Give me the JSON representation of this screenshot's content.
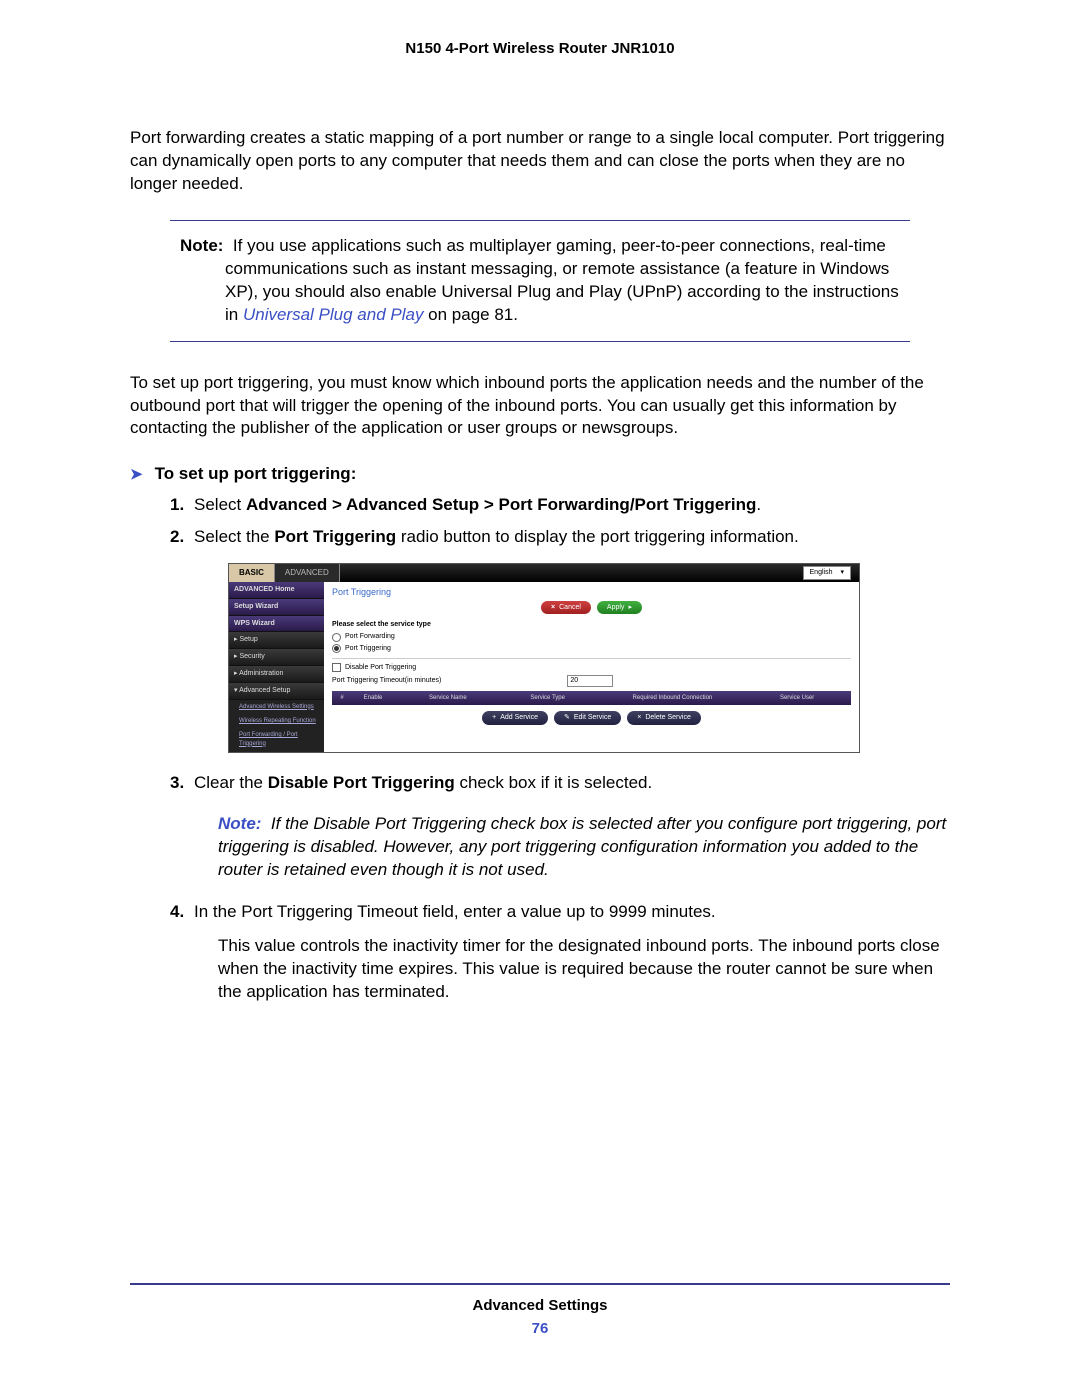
{
  "header": "N150 4-Port Wireless Router JNR1010",
  "intro": "Port forwarding creates a static mapping of a port number or range to a single local computer. Port triggering can dynamically open ports to any computer that needs them and can close the ports when they are no longer needed.",
  "note1": {
    "label": "Note:",
    "text_a": "If you use applications such as multiplayer gaming, peer-to-peer connections, real-time communications such as instant messaging, or remote assistance (a feature in Windows XP), you should also enable Universal Plug and Play (UPnP) according to the instructions in ",
    "link": "Universal Plug and Play",
    "text_b": " on page 81."
  },
  "para2": "To set up port triggering, you must know which inbound ports the application needs and the number of the outbound port that will trigger the opening of the inbound ports. You can usually get this information by contacting the publisher of the application or user groups or newsgroups.",
  "task_heading": "To set up port triggering:",
  "steps": {
    "s1_a": "Select ",
    "s1_b": "Advanced > Advanced Setup > Port Forwarding/Port Triggering",
    "s1_c": ".",
    "s2_a": "Select the ",
    "s2_b": "Port Triggering",
    "s2_c": " radio button to display the port triggering information.",
    "s3_a": "Clear the ",
    "s3_b": "Disable Port Triggering",
    "s3_c": " check box if it is selected.",
    "s4": "In the Port Triggering Timeout field, enter a value up to 9999 minutes.",
    "s4_para": "This value controls the inactivity timer for the designated inbound ports. The inbound ports close when the inactivity time expires. This value is required because the router cannot be sure when the application has terminated."
  },
  "note2": {
    "label": "Note:",
    "text": "If the Disable Port Triggering check box is selected after you configure port triggering, port triggering is disabled. However, any port triggering configuration information you added to the router is retained even though it is not used."
  },
  "screenshot": {
    "tabs": {
      "basic": "BASIC",
      "advanced": "ADVANCED"
    },
    "language": "English",
    "side": {
      "home": "ADVANCED Home",
      "setup_wizard": "Setup Wizard",
      "wps": "WPS Wizard",
      "setup": "▸ Setup",
      "security": "▸ Security",
      "admin": "▸ Administration",
      "adv_setup": "▾ Advanced Setup",
      "sub1": "Advanced Wireless Settings",
      "sub2": "Wireless Repeating Function",
      "sub3": "Port Forwarding / Port Triggering"
    },
    "main": {
      "title": "Port Triggering",
      "cancel": "Cancel",
      "apply": "Apply",
      "select_label": "Please select the service type",
      "r1": "Port Forwarding",
      "r2": "Port Triggering",
      "disable": "Disable Port Triggering",
      "timeout_label": "Port Triggering Timeout(in minutes)",
      "timeout_value": "20",
      "th_num": "#",
      "th_enable": "Enable",
      "th_name": "Service Name",
      "th_type": "Service Type",
      "th_inbound": "Required Inbound Connection",
      "th_user": "Service User",
      "add": "Add Service",
      "edit": "Edit Service",
      "del": "Delete Service"
    }
  },
  "footer": {
    "title": "Advanced Settings",
    "page": "76"
  }
}
